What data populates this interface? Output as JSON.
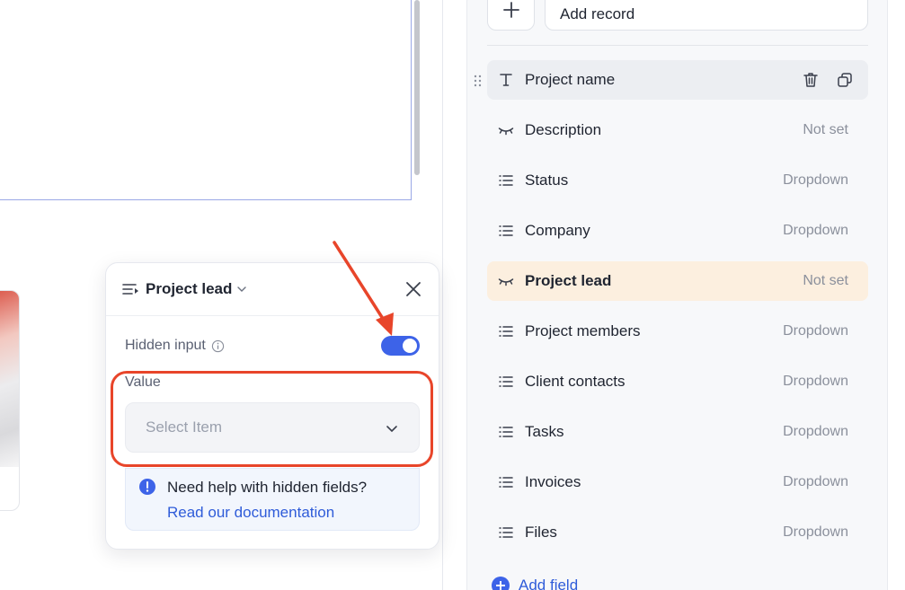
{
  "popover": {
    "title": "Project lead",
    "hidden_input_label": "Hidden input",
    "hidden_input_enabled": true,
    "value_label": "Value",
    "select_placeholder": "Select Item",
    "help_title": "Need help with hidden fields?",
    "help_link": "Read our documentation"
  },
  "panel": {
    "add_record_label": "Add record",
    "add_field_label": "Add field",
    "fields": [
      {
        "name": "Project name",
        "type": "",
        "icon": "text-icon"
      },
      {
        "name": "Description",
        "type": "Not set",
        "icon": "eye-closed-icon"
      },
      {
        "name": "Status",
        "type": "Dropdown",
        "icon": "list-icon"
      },
      {
        "name": "Company",
        "type": "Dropdown",
        "icon": "list-icon"
      },
      {
        "name": "Project lead",
        "type": "Not set",
        "icon": "eye-closed-icon"
      },
      {
        "name": "Project members",
        "type": "Dropdown",
        "icon": "list-icon"
      },
      {
        "name": "Client contacts",
        "type": "Dropdown",
        "icon": "list-icon"
      },
      {
        "name": "Tasks",
        "type": "Dropdown",
        "icon": "list-icon"
      },
      {
        "name": "Invoices",
        "type": "Dropdown",
        "icon": "list-icon"
      },
      {
        "name": "Files",
        "type": "Dropdown",
        "icon": "list-icon"
      }
    ]
  },
  "colors": {
    "accent": "#3d63e8",
    "link": "#2f5cd9",
    "highlight_row": "#fcefdf",
    "annotation": "#e8452a"
  }
}
